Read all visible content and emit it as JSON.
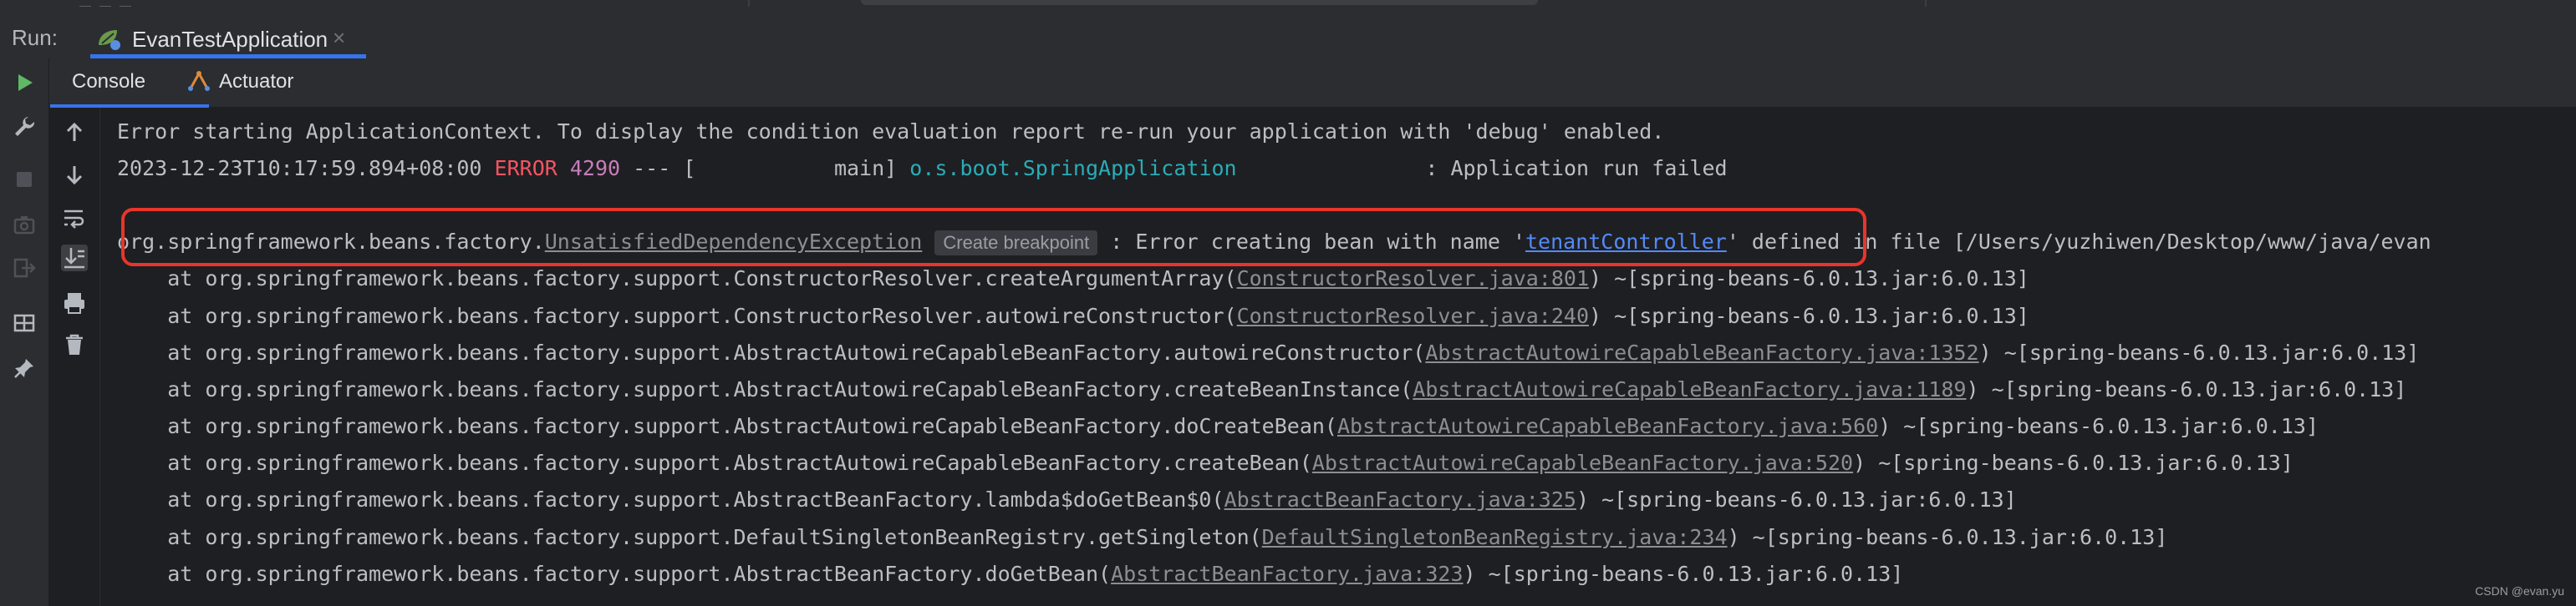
{
  "run_bar": {
    "label": "Run:",
    "tab_label": "EvanTestApplication",
    "tab_close": "×"
  },
  "tabs": {
    "console": "Console",
    "actuator": "Actuator"
  },
  "console": {
    "line1": "Error starting ApplicationContext. To display the condition evaluation report re-run your application with 'debug' enabled.",
    "line2": {
      "timestamp": "2023-12-23T10:17:59.894+08:00 ",
      "level": "ERROR",
      "pid": " 4290",
      "sep": " --- [           main] ",
      "logger": "o.s.boot.SpringApplication",
      "message": "               : Application run failed"
    },
    "exception": {
      "prefix": "org.springframework.beans.factory.",
      "class_link": "UnsatisfiedDependencyException",
      "breakpoint_hint": "Create breakpoint",
      "message": " : Error creating bean with name '",
      "bean_link": "tenantController",
      "suffix": "' defined in file [/Users/yuzhiwen/Desktop/www/java/evan"
    },
    "stack": [
      {
        "at": "    at org.springframework.beans.factory.support.ConstructorResolver.createArgumentArray(",
        "link": "ConstructorResolver.java:801",
        "tail": ") ~[spring-beans-6.0.13.jar:6.0.13]"
      },
      {
        "at": "    at org.springframework.beans.factory.support.ConstructorResolver.autowireConstructor(",
        "link": "ConstructorResolver.java:240",
        "tail": ") ~[spring-beans-6.0.13.jar:6.0.13]"
      },
      {
        "at": "    at org.springframework.beans.factory.support.AbstractAutowireCapableBeanFactory.autowireConstructor(",
        "link": "AbstractAutowireCapableBeanFactory.java:1352",
        "tail": ") ~[spring-beans-6.0.13.jar:6.0.13]"
      },
      {
        "at": "    at org.springframework.beans.factory.support.AbstractAutowireCapableBeanFactory.createBeanInstance(",
        "link": "AbstractAutowireCapableBeanFactory.java:1189",
        "tail": ") ~[spring-beans-6.0.13.jar:6.0.13]"
      },
      {
        "at": "    at org.springframework.beans.factory.support.AbstractAutowireCapableBeanFactory.doCreateBean(",
        "link": "AbstractAutowireCapableBeanFactory.java:560",
        "tail": ") ~[spring-beans-6.0.13.jar:6.0.13]"
      },
      {
        "at": "    at org.springframework.beans.factory.support.AbstractAutowireCapableBeanFactory.createBean(",
        "link": "AbstractAutowireCapableBeanFactory.java:520",
        "tail": ") ~[spring-beans-6.0.13.jar:6.0.13]"
      },
      {
        "at": "    at org.springframework.beans.factory.support.AbstractBeanFactory.lambda$doGetBean$0(",
        "link": "AbstractBeanFactory.java:325",
        "tail": ") ~[spring-beans-6.0.13.jar:6.0.13]"
      },
      {
        "at": "    at org.springframework.beans.factory.support.DefaultSingletonBeanRegistry.getSingleton(",
        "link": "DefaultSingletonBeanRegistry.java:234",
        "tail": ") ~[spring-beans-6.0.13.jar:6.0.13]"
      },
      {
        "at": "    at org.springframework.beans.factory.support.AbstractBeanFactory.doGetBean(",
        "link": "AbstractBeanFactory.java:323",
        "tail": ") ~[spring-beans-6.0.13.jar:6.0.13]"
      }
    ]
  },
  "watermark": "CSDN @evan.yu",
  "colors": {
    "accent": "#3574f0",
    "error": "#f75464",
    "highlight": "#e8352b",
    "run_green": "#5fb865"
  },
  "icons": {
    "rerun": "play-icon",
    "settings": "wrench-icon",
    "stop": "stop-icon",
    "screenshot": "camera-icon",
    "login": "login-icon",
    "layout": "layout-icon",
    "pin": "pin-icon",
    "up": "arrow-up-icon",
    "down": "arrow-down-icon",
    "wrap": "soft-wrap-icon",
    "scroll": "scroll-to-end-icon",
    "print": "print-icon",
    "clear": "trash-icon"
  }
}
